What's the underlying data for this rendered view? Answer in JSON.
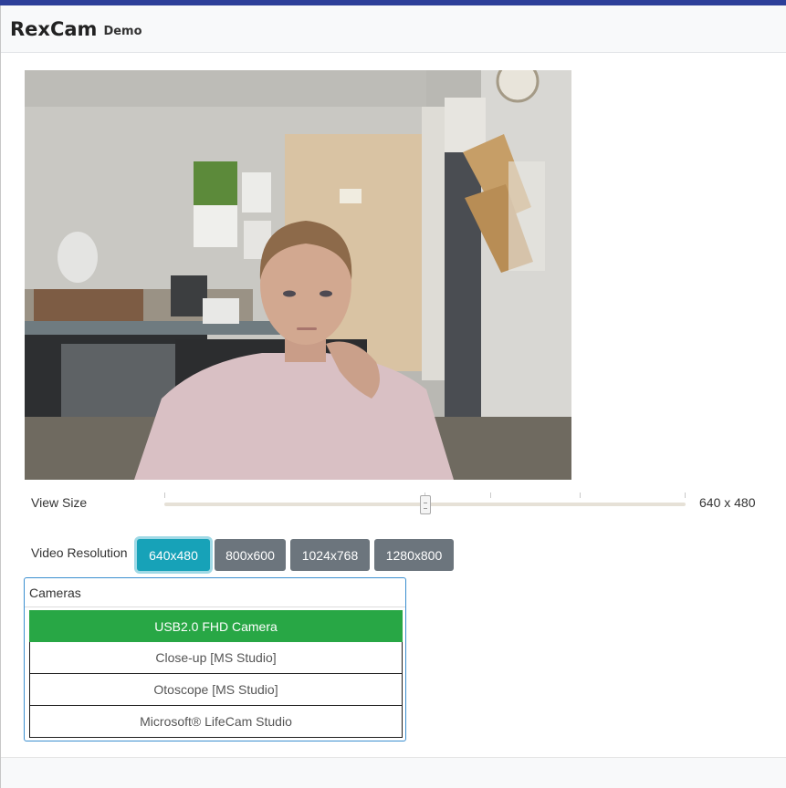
{
  "header": {
    "brand": "RexCam",
    "subtitle": "Demo"
  },
  "video": {
    "description_icon": "camera-feed"
  },
  "view_size": {
    "label": "View Size",
    "value_text": "640 x 480",
    "slider_position": 0.5
  },
  "resolution": {
    "label": "Video Resolution",
    "options": [
      "640x480",
      "800x600",
      "1024x768",
      "1280x800"
    ],
    "selected": "640x480"
  },
  "cameras": {
    "title": "Cameras",
    "items": [
      "USB2.0 FHD Camera",
      "Close-up [MS Studio]",
      "Otoscope [MS Studio]",
      "Microsoft® LifeCam Studio"
    ],
    "selected": "USB2.0 FHD Camera"
  },
  "colors": {
    "accent_bar": "#2d3f99",
    "active_resolution": "#17a2b8",
    "inactive_resolution": "#6c757d",
    "active_camera": "#28a745",
    "panel_border": "#3b8fd0"
  }
}
